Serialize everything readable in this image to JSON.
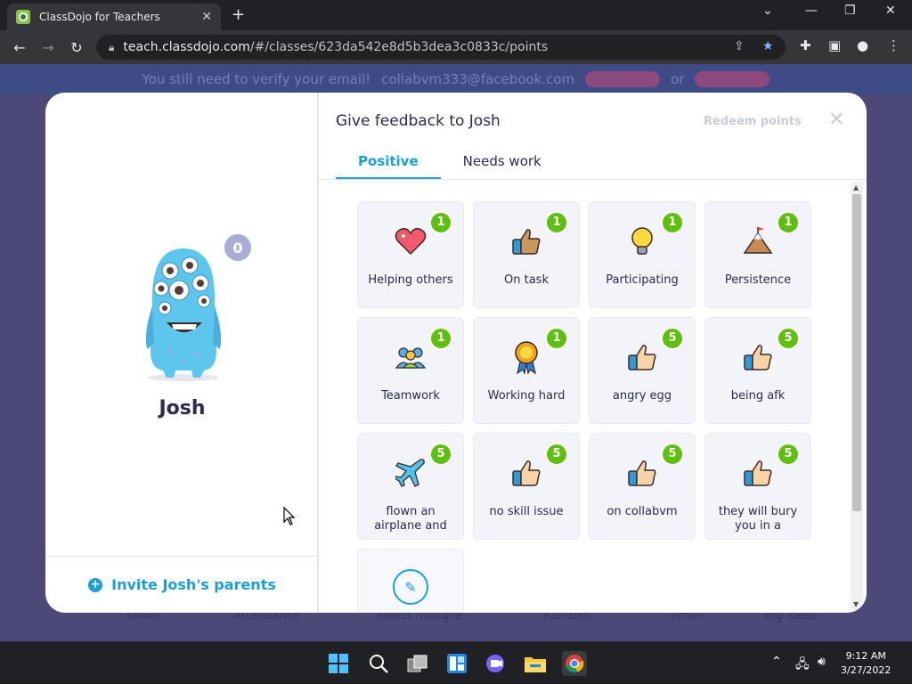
{
  "browser": {
    "tab_title": "ClassDojo for Teachers",
    "url_host": "teach.classdojo.com",
    "url_path": "/#/classes/623da542e8d5b3dea3c0833c/points"
  },
  "banner": {
    "text": "You still need to verify your email!",
    "email": "collabvm333@facebook.com",
    "or": "or"
  },
  "student": {
    "name": "Josh",
    "points": "0",
    "invite_label": "Invite Josh's parents"
  },
  "feedback": {
    "title": "Give feedback to Josh",
    "redeem_label": "Redeem points",
    "tabs": [
      "Positive",
      "Needs work"
    ],
    "skills": [
      {
        "label": "Helping others",
        "points": "1",
        "icon": "heart-icon"
      },
      {
        "label": "On task",
        "points": "1",
        "icon": "thumbs-up-icon"
      },
      {
        "label": "Participating",
        "points": "1",
        "icon": "lightbulb-icon"
      },
      {
        "label": "Persistence",
        "points": "1",
        "icon": "mountain-icon"
      },
      {
        "label": "Teamwork",
        "points": "1",
        "icon": "team-icon"
      },
      {
        "label": "Working hard",
        "points": "1",
        "icon": "medal-icon"
      },
      {
        "label": "angry egg",
        "points": "5",
        "icon": "thumbs-up-icon"
      },
      {
        "label": "being afk",
        "points": "5",
        "icon": "thumbs-up-icon"
      },
      {
        "label": "flown an airplane and",
        "points": "5",
        "icon": "airplane-icon"
      },
      {
        "label": "no skill issue",
        "points": "5",
        "icon": "thumbs-up-icon"
      },
      {
        "label": "on collabvm",
        "points": "5",
        "icon": "thumbs-up-icon"
      },
      {
        "label": "they will bury you in a",
        "points": "5",
        "icon": "thumbs-up-icon"
      }
    ]
  },
  "background": {
    "bottom_items": [
      "Toolkit",
      "Attendance",
      "Select multiple",
      "Random",
      "Timer",
      "Big ideas"
    ]
  },
  "taskbar": {
    "time": "9:12 AM",
    "date": "3/27/2022"
  }
}
